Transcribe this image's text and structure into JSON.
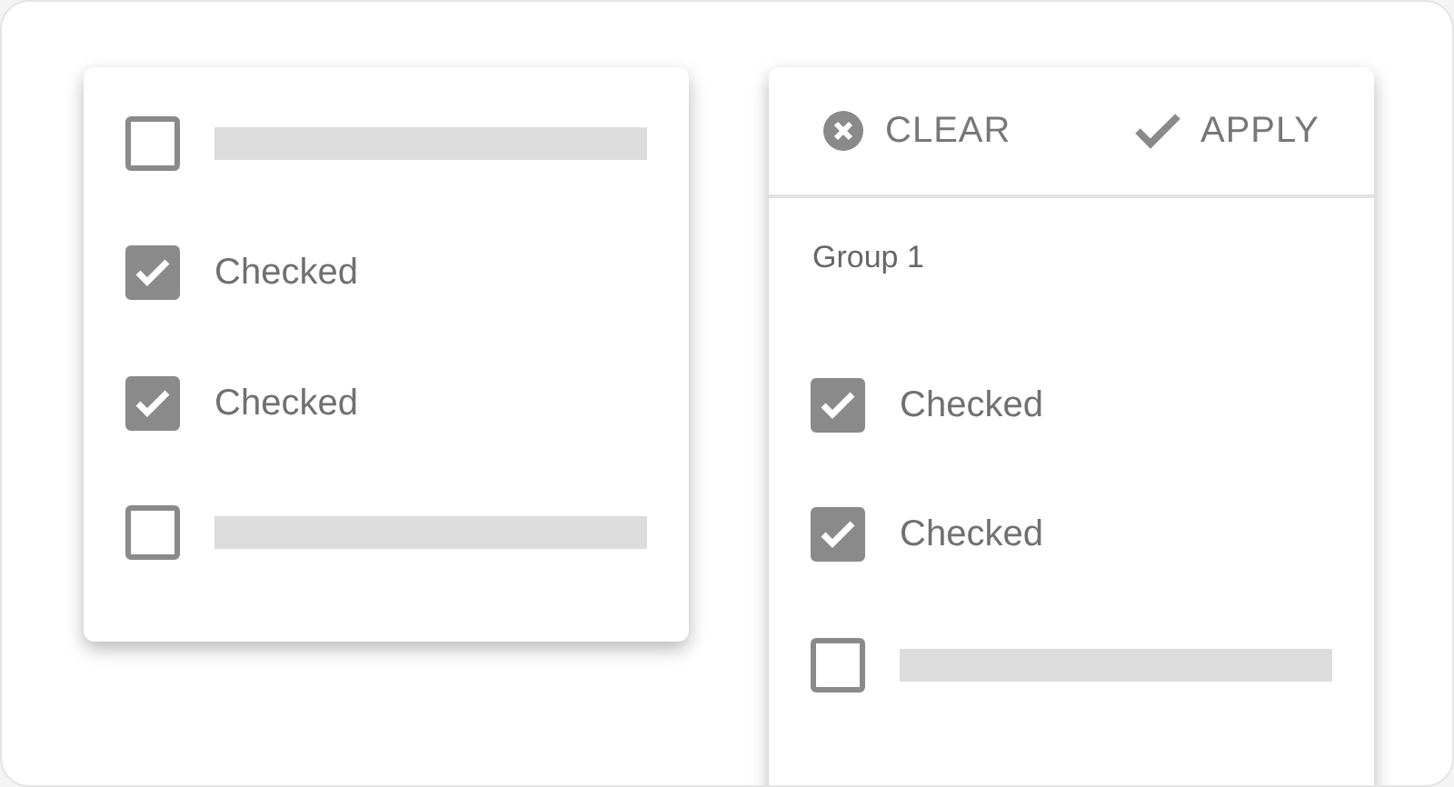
{
  "left_panel": {
    "items": [
      {
        "kind": "placeholder",
        "checked": false
      },
      {
        "kind": "text",
        "label": "Checked",
        "checked": true
      },
      {
        "kind": "text",
        "label": "Checked",
        "checked": true
      },
      {
        "kind": "placeholder",
        "checked": false
      }
    ]
  },
  "right_panel": {
    "actions": [
      {
        "kind": "clear",
        "label": "CLEAR"
      },
      {
        "kind": "apply",
        "label": "APPLY"
      }
    ],
    "group_label": "Group 1",
    "items": [
      {
        "kind": "text",
        "label": "Checked",
        "checked": true
      },
      {
        "kind": "text",
        "label": "Checked",
        "checked": true
      },
      {
        "kind": "placeholder",
        "checked": false
      }
    ]
  }
}
